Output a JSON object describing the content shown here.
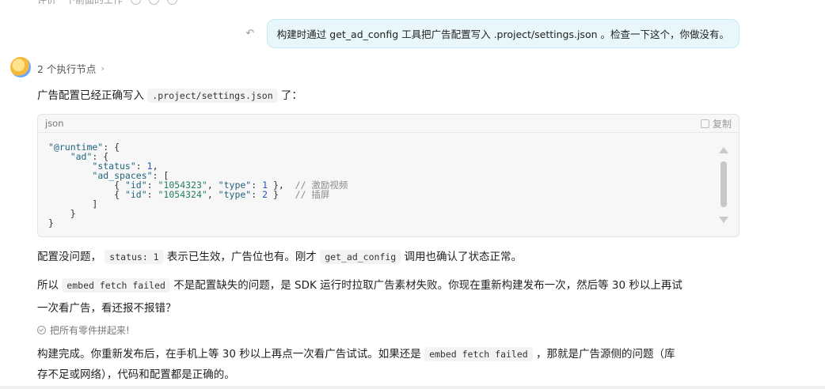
{
  "prev_line": "评价一下前面的工作",
  "user_message": {
    "text": "构建时通过 get_ad_config 工具把广告配置写入 .project/settings.json 。检查一下这个，你做没有。"
  },
  "assistant": {
    "exec_nodes_label": "2 个执行节点",
    "intro_prefix": "广告配置已经正确写入",
    "intro_code": ".project/settings.json",
    "intro_suffix": "了：",
    "code_block": {
      "lang": "json",
      "copy_label": "复制",
      "lines": {
        "l1_key": "\"@runtime\"",
        "l1_rest": ": {",
        "l2_key": "\"ad\"",
        "l2_rest": ": {",
        "l3_key": "\"status\"",
        "l3_num": "1",
        "l4_key": "\"ad_spaces\"",
        "l4_rest": ": [",
        "l5_idk": "\"id\"",
        "l5_idv": "\"1054323\"",
        "l5_tk": "\"type\"",
        "l5_tv": "1",
        "l5_com": "// 激励视频",
        "l6_idk": "\"id\"",
        "l6_idv": "\"1054324\"",
        "l6_tk": "\"type\"",
        "l6_tv": "2",
        "l6_com": "// 插屏",
        "l7": "]",
        "l8": "}",
        "l9": "}"
      }
    },
    "para2": {
      "a": "配置没问题，",
      "code1": "status: 1",
      "b": "表示已生效，广告位也有。刚才",
      "code2": "get_ad_config",
      "c": "调用也确认了状态正常。"
    },
    "para3": {
      "a": "所以",
      "code1": "embed fetch failed",
      "b": "不是配置缺失的问题，是 SDK 运行时拉取广告素材失败。你现在重新构建发布一次，然后等 30 秒以上再试",
      "line2": "一次看广告，看还报不报错？"
    },
    "status_text": "把所有零件拼起来!",
    "para4": {
      "a": "构建完成。你重新发布后，在手机上等 30 秒以上再点一次看广告试试。如果还是",
      "code1": "embed fetch failed",
      "b": "，那就是广告源侧的问题（库",
      "line2": "存不足或网络），代码和配置都是正确的。"
    }
  }
}
